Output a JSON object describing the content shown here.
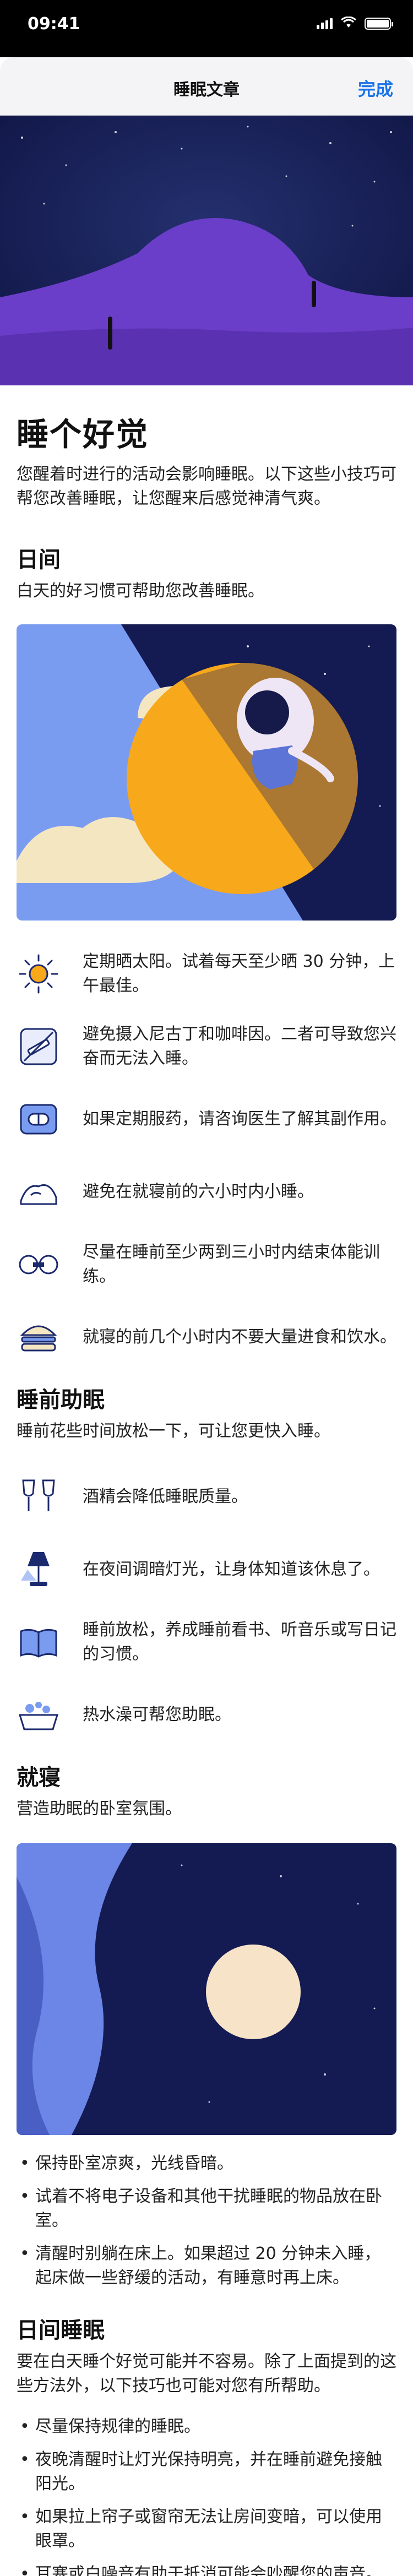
{
  "status": {
    "time": "09:41"
  },
  "nav": {
    "title": "睡眠文章",
    "done_label": "完成"
  },
  "article": {
    "title": "睡个好觉",
    "intro": "您醒着时进行的活动会影响睡眠。以下这些小技巧可帮您改善睡眠，让您醒来后感觉神清气爽。",
    "sections": {
      "day": {
        "heading": "日间",
        "subtitle": "白天的好习惯可帮助您改善睡眠。",
        "tips": [
          {
            "icon": "sun-icon",
            "text": "定期晒太阳。试着每天至少晒 30 分钟，上午最佳。"
          },
          {
            "icon": "no-smoking-icon",
            "text": "避免摄入尼古丁和咖啡因。二者可导致您兴奋而无法入睡。"
          },
          {
            "icon": "pill-icon",
            "text": "如果定期服药，请咨询医生了解其副作用。"
          },
          {
            "icon": "nap-icon",
            "text": "避免在就寝前的六小时内小睡。"
          },
          {
            "icon": "dumbbell-icon",
            "text": "尽量在睡前至少两到三小时内结束体能训练。"
          },
          {
            "icon": "burger-icon",
            "text": "就寝的前几个小时内不要大量进食和饮水。"
          }
        ]
      },
      "before_bed": {
        "heading": "睡前助眠",
        "subtitle": "睡前花些时间放松一下，可让您更快入睡。",
        "tips": [
          {
            "icon": "wine-glasses-icon",
            "text": "酒精会降低睡眠质量。"
          },
          {
            "icon": "lamp-icon",
            "text": "在夜间调暗灯光，让身体知道该休息了。"
          },
          {
            "icon": "book-icon",
            "text": "睡前放松，养成睡前看书、听音乐或写日记的习惯。"
          },
          {
            "icon": "bathtub-icon",
            "text": "热水澡可帮您助眠。"
          }
        ]
      },
      "bedtime": {
        "heading": "就寝",
        "subtitle": "营造助眠的卧室氛围。",
        "bullets": [
          "保持卧室凉爽，光线昏暗。",
          "试着不将电子设备和其他干扰睡眠的物品放在卧室。",
          "清醒时别躺在床上。如果超过 20 分钟未入睡，起床做一些舒缓的活动，有睡意时再上床。"
        ]
      },
      "day_sleep": {
        "heading": "日间睡眠",
        "subtitle": "要在白天睡个好觉可能并不容易。除了上面提到的这些方法外，以下技巧也可能对您有所帮助。",
        "bullets": [
          "尽量保持规律的睡眠。",
          "夜晚清醒时让灯光保持明亮，并在睡前避免接触阳光。",
          "如果拉上帘子或窗帘无法让房间变暗，可以使用眼罩。",
          "耳塞或白噪音有助于抵消可能会吵醒您的声音。"
        ]
      }
    }
  },
  "colors": {
    "accent": "#1a73e8",
    "night": "#1a1d5c",
    "purple": "#6b3ec9",
    "orange": "#f7a81b",
    "sky_blue": "#7a9cf0"
  }
}
